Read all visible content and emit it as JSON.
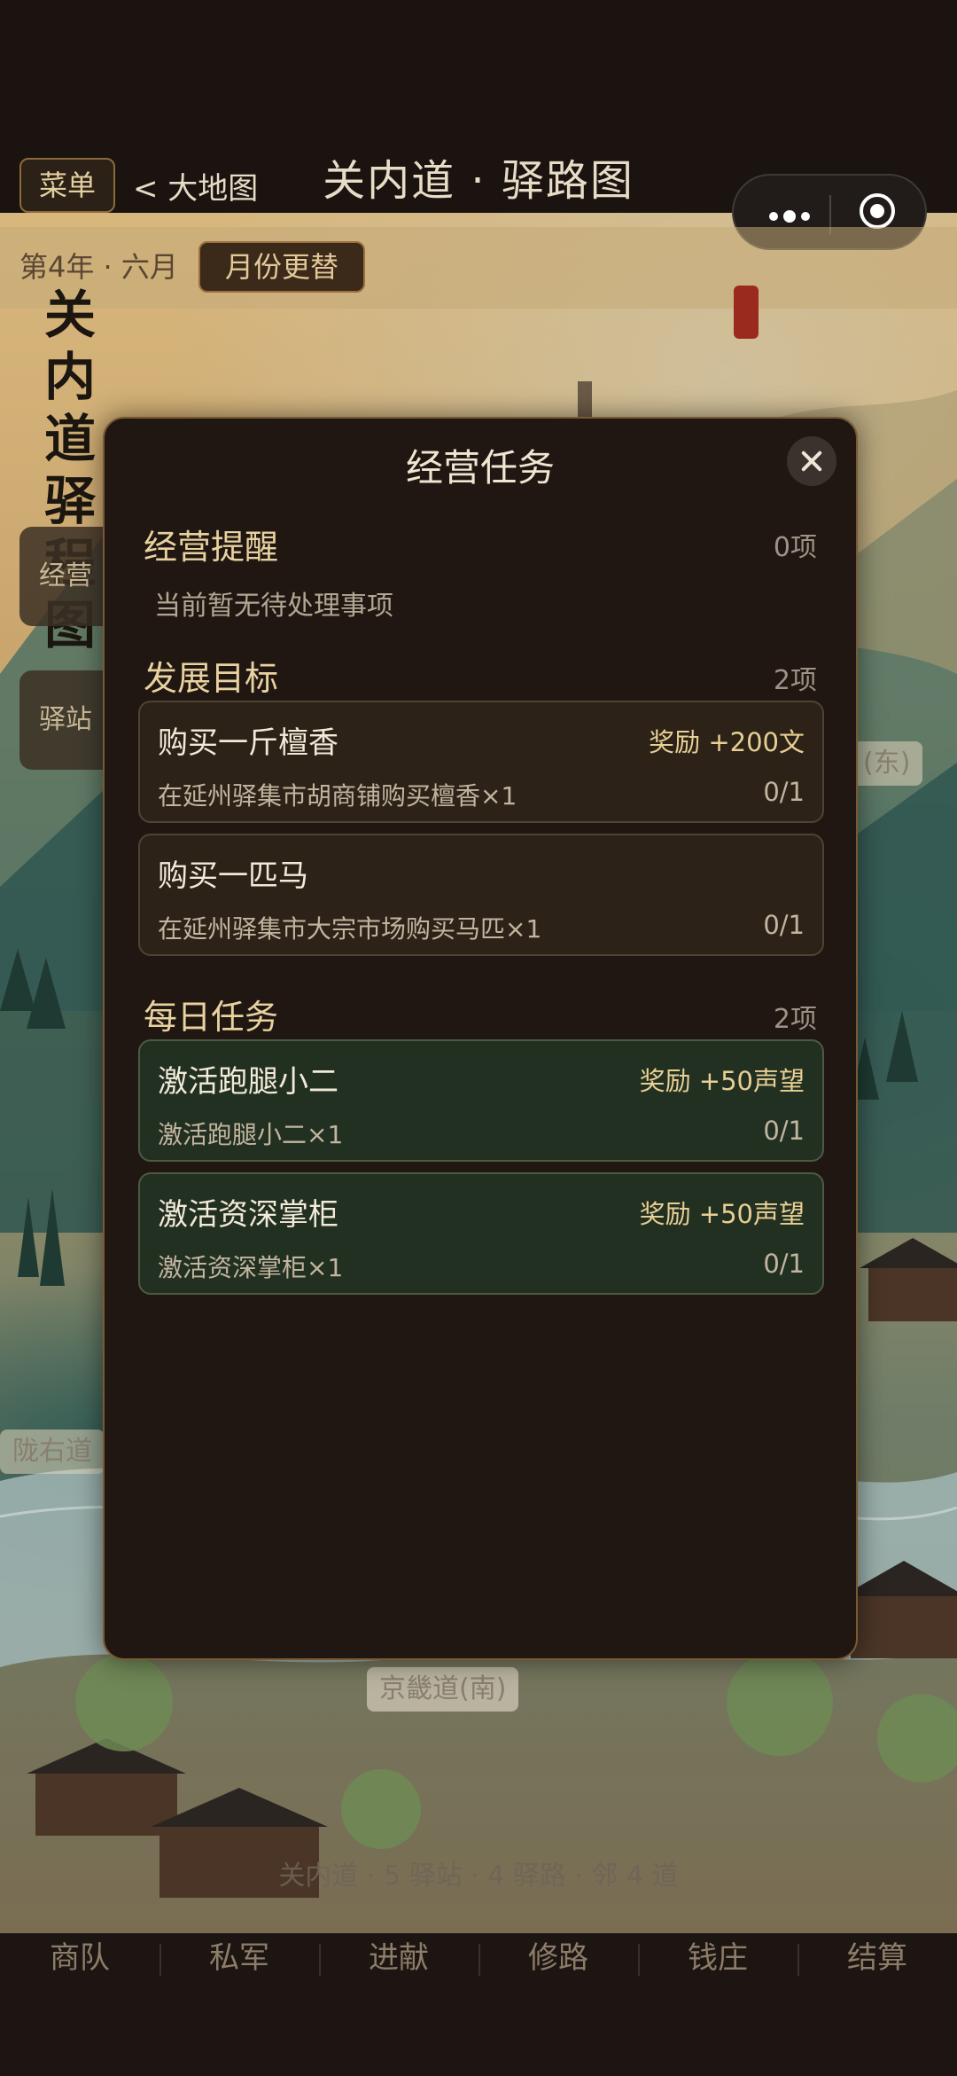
{
  "header": {
    "menu_label": "菜单",
    "back_label": "< 大地图",
    "title": "关内道 · 驿路图"
  },
  "datebar": {
    "date": "第4年 · 六月",
    "month_button": "月份更替"
  },
  "map": {
    "vertical_title": [
      "关",
      "内",
      "道",
      "驿",
      "程",
      "图"
    ],
    "side_tabs": [
      "经营",
      "驿站"
    ],
    "labels": {
      "east": "(东)",
      "longyou": "陇右道",
      "jingji": "京畿道(南)"
    },
    "stats": "关内道 · 5 驿站 · 4 驿路 · 邻 4 道"
  },
  "modal": {
    "title": "经营任务",
    "sections": {
      "reminders": {
        "title": "经营提醒",
        "count": "0项",
        "empty": "当前暂无待处理事项"
      },
      "goals": {
        "title": "发展目标",
        "count": "2项",
        "items": [
          {
            "title": "购买一斤檀香",
            "reward": "奖励 +200文",
            "desc": "在延州驿集市胡商铺购买檀香×1",
            "progress": "0/1"
          },
          {
            "title": "购买一匹马",
            "reward": "",
            "desc": "在延州驿集市大宗市场购买马匹×1",
            "progress": "0/1"
          }
        ]
      },
      "daily": {
        "title": "每日任务",
        "count": "2项",
        "items": [
          {
            "title": "激活跑腿小二",
            "reward": "奖励 +50声望",
            "desc": "激活跑腿小二×1",
            "progress": "0/1"
          },
          {
            "title": "激活资深掌柜",
            "reward": "奖励 +50声望",
            "desc": "激活资深掌柜×1",
            "progress": "0/1"
          }
        ]
      }
    }
  },
  "bottom_nav": [
    "商队",
    "私军",
    "进献",
    "修路",
    "钱庄",
    "结算"
  ]
}
